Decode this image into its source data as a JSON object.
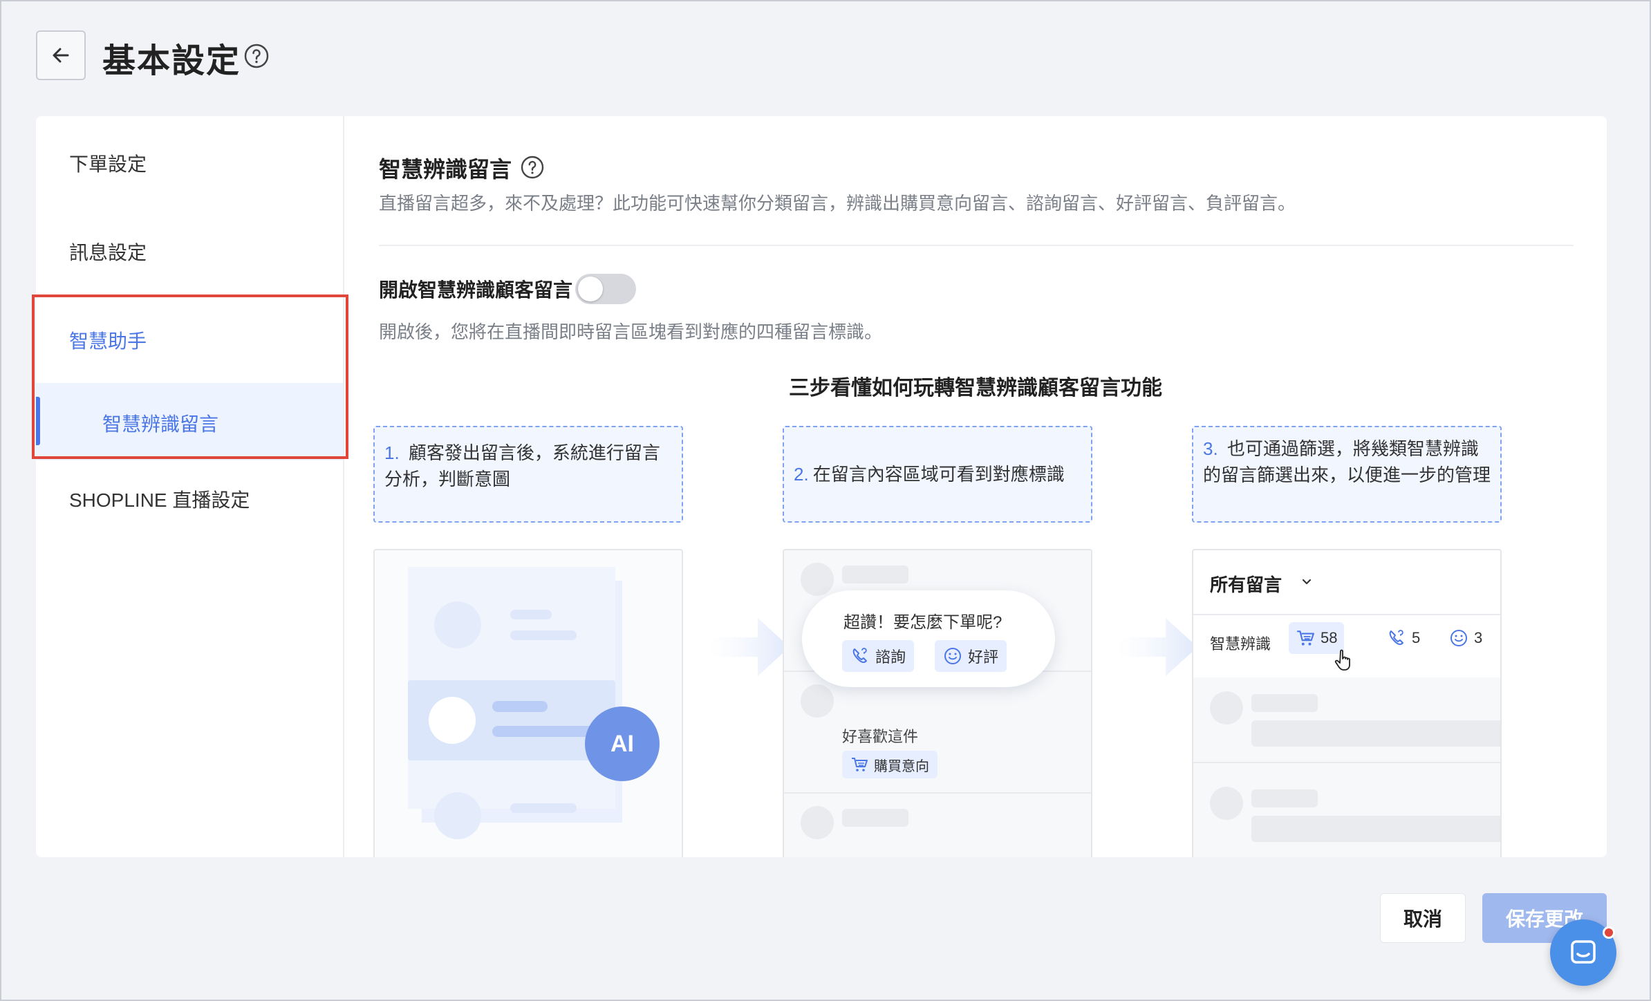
{
  "header": {
    "title": "基本設定",
    "back_icon": "arrow-left-icon",
    "help_icon": "question-circle-icon"
  },
  "sidebar": {
    "items": [
      {
        "label": "下單設定",
        "active": false
      },
      {
        "label": "訊息設定",
        "active": false
      },
      {
        "label": "智慧助手",
        "active": true
      },
      {
        "label": "智慧辨識留言",
        "active": true,
        "sub": true
      },
      {
        "label": "SHOPLINE 直播設定",
        "active": false
      }
    ]
  },
  "main": {
    "title": "智慧辨識留言",
    "description": "直播留言超多，來不及處理？此功能可快速幫你分類留言，辨識出購買意向留言、諮詢留言、好評留言、負評留言。",
    "toggle": {
      "label": "開啟智慧辨識顧客留言",
      "on": false
    },
    "toggle_hint": "開啟後，您將在直播間即時留言區塊看到對應的四種留言標識。",
    "steps_title": "三步看懂如何玩轉智慧辨識顧客留言功能",
    "steps": [
      {
        "num": "1.",
        "text": "顧客發出留言後，系統進行留言分析，判斷意圖"
      },
      {
        "num": "2.",
        "text": "在留言內容區域可看到對應標識"
      },
      {
        "num": "3.",
        "text": "也可通過篩選，將幾類智慧辨識的留言篩選出來，以便進一步的管理"
      }
    ],
    "illus1": {
      "badge": "AI"
    },
    "illus2": {
      "bubble_text": "超讚！要怎麼下單呢?",
      "tag_inquiry": "諮詢",
      "tag_praise": "好評",
      "comment": "好喜歡這件",
      "tag_purchase": "購買意向"
    },
    "illus3": {
      "filter_label": "所有留言",
      "ai_label": "智慧辨識",
      "count_purchase": "58",
      "count_inquiry": "5",
      "count_praise": "3"
    }
  },
  "footer": {
    "cancel": "取消",
    "save": "保存更改"
  },
  "colors": {
    "accent": "#4a76e6",
    "highlight_border": "#e0463a",
    "save_disabled": "#9fb8ee"
  }
}
